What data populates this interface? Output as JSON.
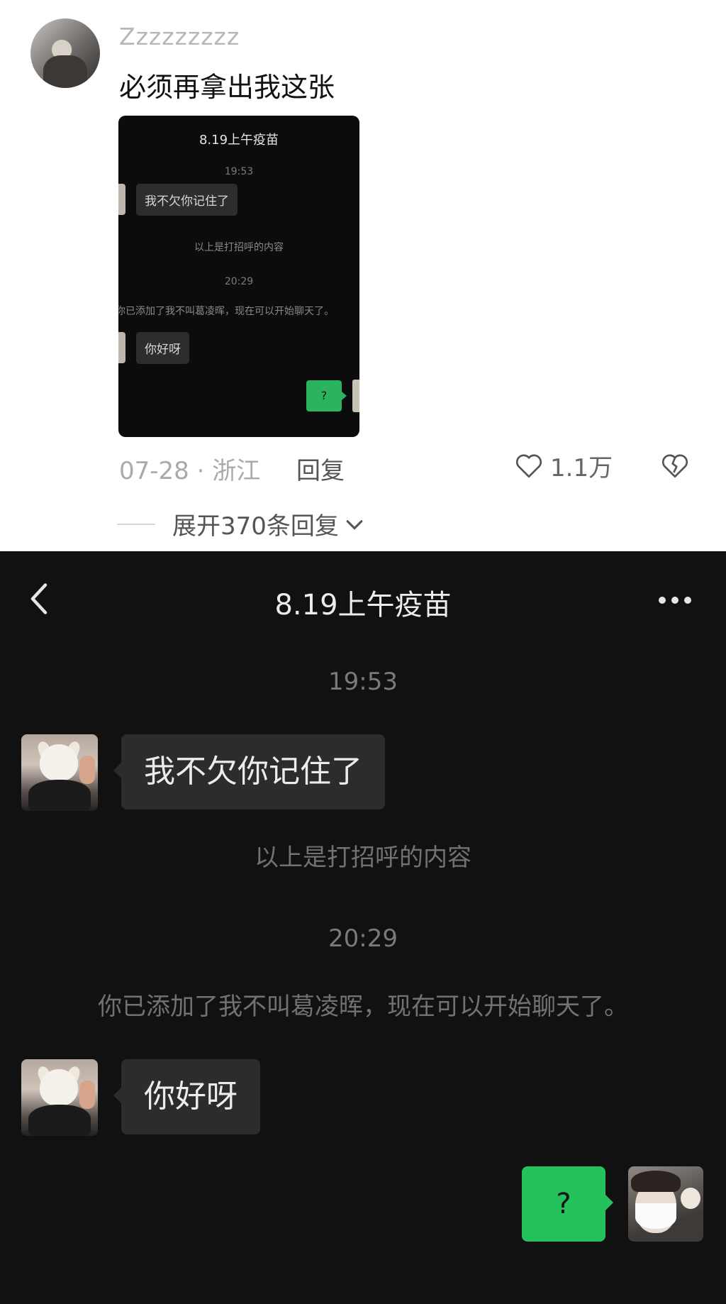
{
  "comment": {
    "username": "Zzzzzzzzz",
    "text": "必须再拿出我这张",
    "date_location": "07-28 · 浙江",
    "reply_label": "回复",
    "like_count": "1.1万",
    "expand_replies": "展开370条回复"
  },
  "thumbnail": {
    "title": "8.19上午疫苗",
    "time1": "19:53",
    "msg1": "我不欠你记住了",
    "sys1": "以上是打招呼的内容",
    "time2": "20:29",
    "sys2": "你已添加了我不叫葛凌晖，现在可以开始聊天了。",
    "msg2": "你好呀",
    "reply": "?"
  },
  "chat": {
    "title": "8.19上午疫苗",
    "timestamp1": "19:53",
    "message1": "我不欠你记住了",
    "system1": "以上是打招呼的内容",
    "timestamp2": "20:29",
    "system2": "你已添加了我不叫葛凌晖，现在可以开始聊天了。",
    "message2": "你好呀",
    "reply": "?"
  },
  "colors": {
    "chat_background": "#111111",
    "incoming_bubble": "#2c2c2c",
    "outgoing_bubble": "#24c15d"
  },
  "icons": [
    "heart-icon",
    "broken-heart-icon",
    "chevron-down-icon",
    "back-arrow-icon",
    "more-icon"
  ]
}
